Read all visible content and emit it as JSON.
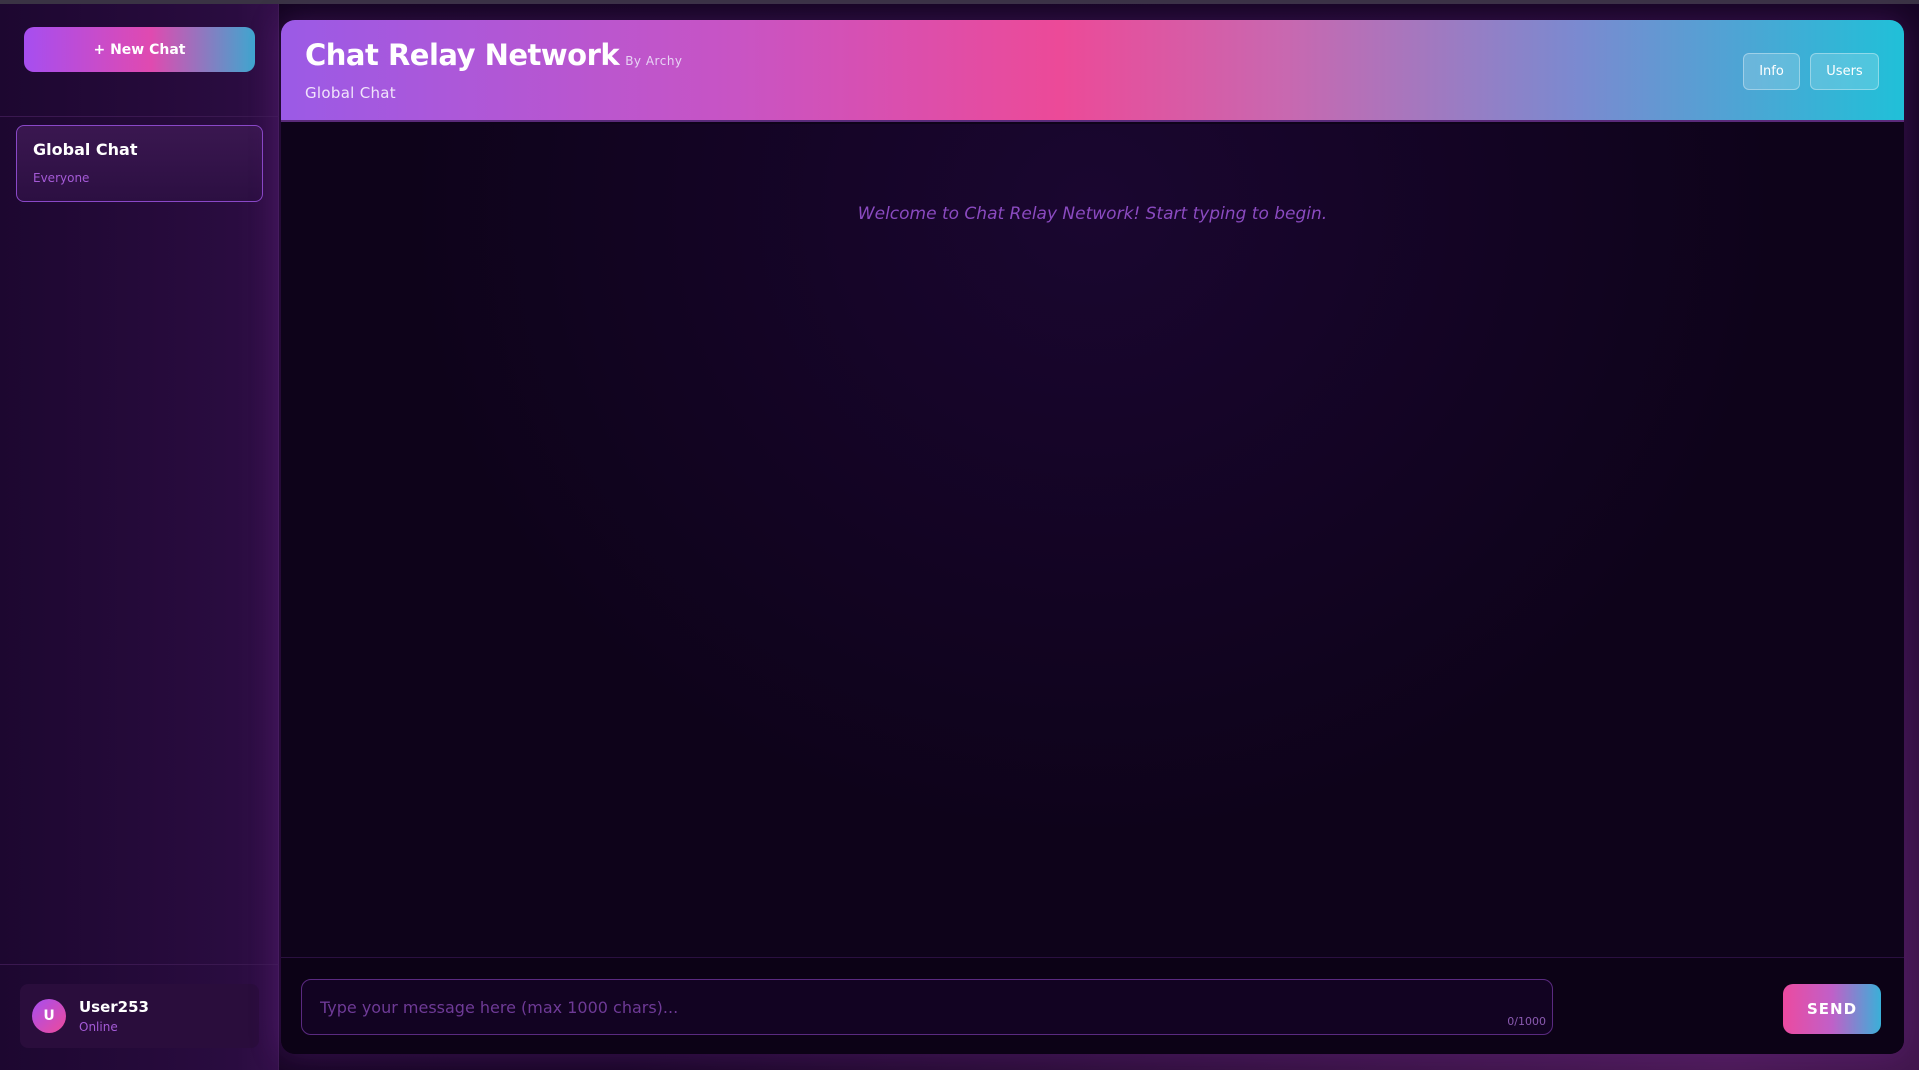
{
  "sidebar": {
    "new_chat_label": "+ New Chat",
    "chats": [
      {
        "title": "Global Chat",
        "subtitle": "Everyone"
      }
    ],
    "user": {
      "avatar_initial": "U",
      "name": "User253",
      "status": "Online"
    }
  },
  "header": {
    "title": "Chat Relay Network",
    "by_line": "By Archy",
    "subtitle": "Global Chat",
    "buttons": {
      "info": "Info",
      "users": "Users"
    }
  },
  "messages": {
    "welcome": "Welcome to Chat Relay Network! Start typing to begin."
  },
  "composer": {
    "placeholder": "Type your message here (max 1000 chars)...",
    "value": "",
    "char_count": "0/1000",
    "send_label": "SEND"
  },
  "colors": {
    "accent_purple": "#a64ef0",
    "accent_pink": "#ec4a98",
    "accent_cyan": "#20c0d8",
    "background": "#12041f"
  }
}
